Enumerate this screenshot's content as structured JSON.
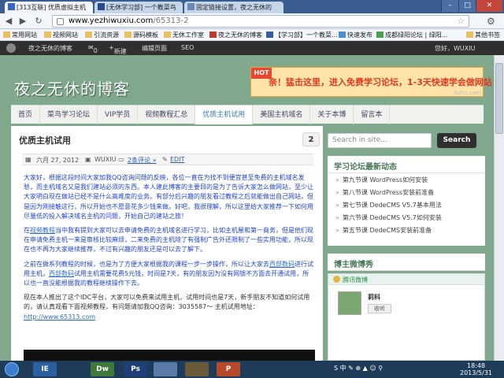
{
  "browser": {
    "tabs": [
      {
        "label": "[313互联] 优质虚拟主机",
        "active": true
      },
      {
        "label": "[无休学习部] 一个教菜鸟",
        "active": false
      },
      {
        "label": "固定链接设置，夜之无休的",
        "active": false
      }
    ],
    "window_buttons": {
      "minimize": "–",
      "maximize": "□",
      "close": "✕"
    },
    "address": {
      "host": "www.yezhiwuxiu.com",
      "path": "/65313-2"
    },
    "bookmarks": [
      "常用网站",
      "视频网站",
      "引流资源",
      "源码模板",
      "无休工作室",
      "夜之无休的博客",
      "【学习部】一个教菜...",
      "快速发布",
      "成都绿阳论坛 | 绿阳...",
      "其他书签"
    ]
  },
  "wp_admin_bar": {
    "site": "夜之无休的博客",
    "comments": "0",
    "new": "新建",
    "edit": "编辑页面",
    "seo": "SEO",
    "greeting": "您好，WUXIU"
  },
  "header": {
    "site_title": "夜之无休的博客",
    "banner_hot": "HOT",
    "banner_text": "亲！猛击这里，进入免费学习论坛，1-3天快速学会做网站！",
    "banner_watermark": "Sohu.com"
  },
  "nav": {
    "items": [
      "首页",
      "菜鸟学习论坛",
      "VIP学员",
      "视频教程汇总",
      "优质主机试用",
      "美国主机域名",
      "关于本博",
      "留言本"
    ],
    "active_index": 4
  },
  "post": {
    "title": "优质主机试用",
    "comment_count": "2",
    "date": "六月 27, 2012",
    "author": "WUXIU",
    "comments_link": "2条评论 »",
    "edit_link": "EDIT",
    "p1": "大家好，根据这段时间大家加我QQ咨询问题的反映，各位一直在为找不到便宜甚至免费的主机域名发愁，而主机域名又是我们建站必须的东西。本人建此博客的主要目的是为了告诉大家怎么做网站，至少让大家明白现在做站已经不是什么高难度的业务。有部分后兴趣的朋友看过教程之后就能做出自己网站，但是因为刚接触这行，所以开始也不愿意花多少钱来做。好吧，我很理解，所以这里给大家推荐一下如何用尽量低的投入解决域名主机的问题，开始自己的建站之旅！",
    "p2_pre": "在",
    "p2_link": "视频教程",
    "p2_post": "当中我有提到大家可以去申请免费的主机域名进行学习，比如主机屋和第一商务，但是他们现在申请免费主机一来是审核比较麻烦，二来免费的主机除了有强制广告外还限制了一些实用功能，所以现在也不再为大家继续推荐，不过有兴趣的朋友还是可以去了解下。",
    "p3_pre": "之前在做系列教程的时候，也是为了方便大家根据我的课程一步一步操作，所以让大家去",
    "p3_link1": "西部数码",
    "p3_mid": "进行试用主机，",
    "p3_link2": "西部数码",
    "p3_post": "试用主机需要花费5元钱，时间是7天，有的朋友因为没有网银不方面去开通试用，所以也一直没能根据我的教程继续操作下去。",
    "p4": "现在本人推出了这个IDC平台，大家可以免费来试用主机，试用时间也是7天，新手朋友不知道如何试用的，请认真观看下面视频教程，有问题请加我QQ咨询：3035587～ 主机试用地址：",
    "p4_link": "http://www.65313.com"
  },
  "sidebar": {
    "search_placeholder": "Search in site...",
    "search_button": "Search",
    "forum_title": "学习论坛最新动态",
    "forum_items": [
      "第九节课 WordPress如何安装",
      "第八节课 WordPress安装前准备",
      "第七节课 DedeCMS V5.7基本用法",
      "第六节课 DedeCMS V5.7如何安装",
      "第五节课 DedeCMS安装前准备"
    ],
    "weibo_title": "博主微博秀",
    "weibo_head": "腾讯微博",
    "weibo_name": "莉科",
    "weibo_follow": "收听"
  },
  "taskbar": {
    "apps": [
      "IE",
      "Dw",
      "Ps",
      "",
      "",
      "P"
    ],
    "tray": "S 中 ✎ ⊕ ▲ ☺ ⚲",
    "time": "18:48",
    "date": "2013/5/31"
  }
}
